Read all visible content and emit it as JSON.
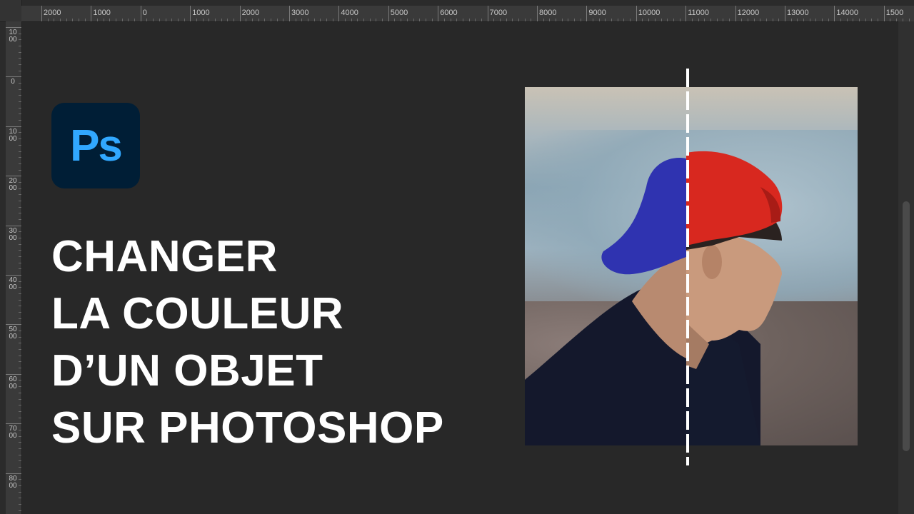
{
  "ruler_top": {
    "labels": [
      "2000",
      "1000",
      "0",
      "1000",
      "2000",
      "3000",
      "4000",
      "5000",
      "6000",
      "7000",
      "8000",
      "9000",
      "10000",
      "11000",
      "12000",
      "13000",
      "14000",
      "1500"
    ]
  },
  "ruler_left": {
    "labels": [
      "1000",
      "0",
      "1000",
      "2000",
      "3000",
      "4000",
      "5000",
      "6000",
      "7000",
      "8000"
    ]
  },
  "logo": {
    "text": "Ps",
    "color": "#31a8ff",
    "background": "#001e36"
  },
  "title": {
    "lines": [
      "CHANGER",
      "LA COULEUR",
      "D’UN OBJET",
      "SUR PHOTOSHOP"
    ]
  },
  "photo": {
    "left_cap_color": "#2f33b0",
    "right_cap_color": "#d8281f"
  },
  "colors": {
    "canvas": "#282828",
    "ruler": "#3a3a3a",
    "text": "#ffffff"
  }
}
